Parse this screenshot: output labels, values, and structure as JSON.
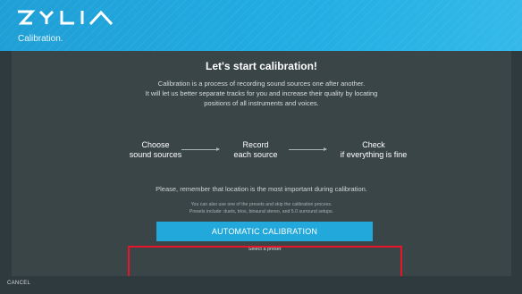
{
  "header": {
    "logo_text": "ZYLIA",
    "subtitle": "Calibration."
  },
  "main": {
    "title": "Let's start calibration!",
    "intro_lines": [
      "Calibration is a process of recording sound sources one after another.",
      "It will let us better separate tracks for you and increase their quality by locating",
      "positions of all instruments and voices."
    ],
    "steps": [
      {
        "line1": "Choose",
        "line2": "sound sources"
      },
      {
        "line1": "Record",
        "line2": "each source"
      },
      {
        "line1": "Check",
        "line2": "if everything is fine"
      }
    ],
    "reminder": "Please, remember that location is the most important during calibration.",
    "preset_note_lines": [
      "You can also use one of the presets and skip the calibration process.",
      "Presets include: duets, trios, binaural stereo, and 5.0 surround setups."
    ],
    "auto_button_label": "AUTOMATIC CALIBRATION",
    "preset_select_label": "Select a preset"
  },
  "footer": {
    "cancel_label": "CANCEL"
  },
  "colors": {
    "header_blue": "#23aee3",
    "panel_bg": "#3a4548",
    "page_bg": "#2f3a3e",
    "button_blue": "#23a8dc",
    "highlight_red": "#e8152a"
  },
  "icons": [
    "zylia-logo",
    "arrow-right-icon"
  ]
}
